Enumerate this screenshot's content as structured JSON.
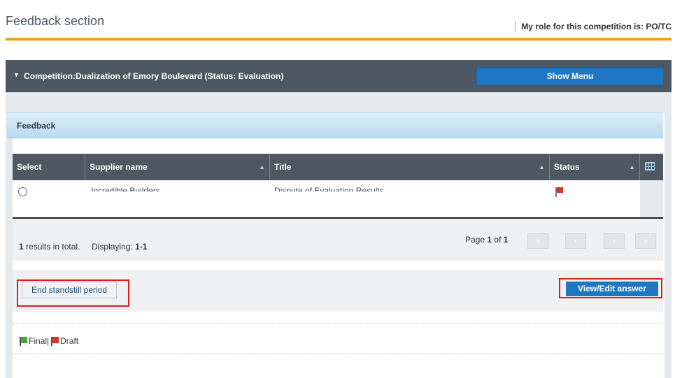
{
  "header": {
    "title": "Feedback section",
    "role_text": "My role for this competition is: PO/TC"
  },
  "competition": {
    "title": "Competition:Dualization of Emory Boulevard (Status: Evaluation)",
    "show_menu_label": "Show Menu"
  },
  "feedback_panel": {
    "title": "Feedback"
  },
  "table": {
    "columns": [
      "Select",
      "Supplier name",
      "Title",
      "Status"
    ],
    "rows": [
      {
        "supplier_name": "Incredible Builders",
        "title": "Dispute of Evaluation Results",
        "status": "Draft"
      }
    ]
  },
  "pager": {
    "results_count": "1",
    "results_suffix": "results in total.",
    "displaying_label": "Displaying:",
    "displaying_range": "1-1",
    "page_prefix": "Page",
    "page_current": "1",
    "page_of": "of",
    "page_total": "1",
    "first": "«",
    "prev": "‹",
    "next": "›",
    "last": "»"
  },
  "actions": {
    "end_standstill_label": "End standstill period",
    "view_edit_label": "View/Edit answer"
  },
  "legend": {
    "final_label": "Final|",
    "draft_label": "Draft"
  },
  "colors": {
    "accent_orange": "#f0a01e",
    "header_dark": "#4e5863",
    "button_blue": "#1f77c4",
    "highlight_red": "#e01c1c",
    "flag_final": "#3aa832",
    "flag_draft": "#e0302e"
  }
}
